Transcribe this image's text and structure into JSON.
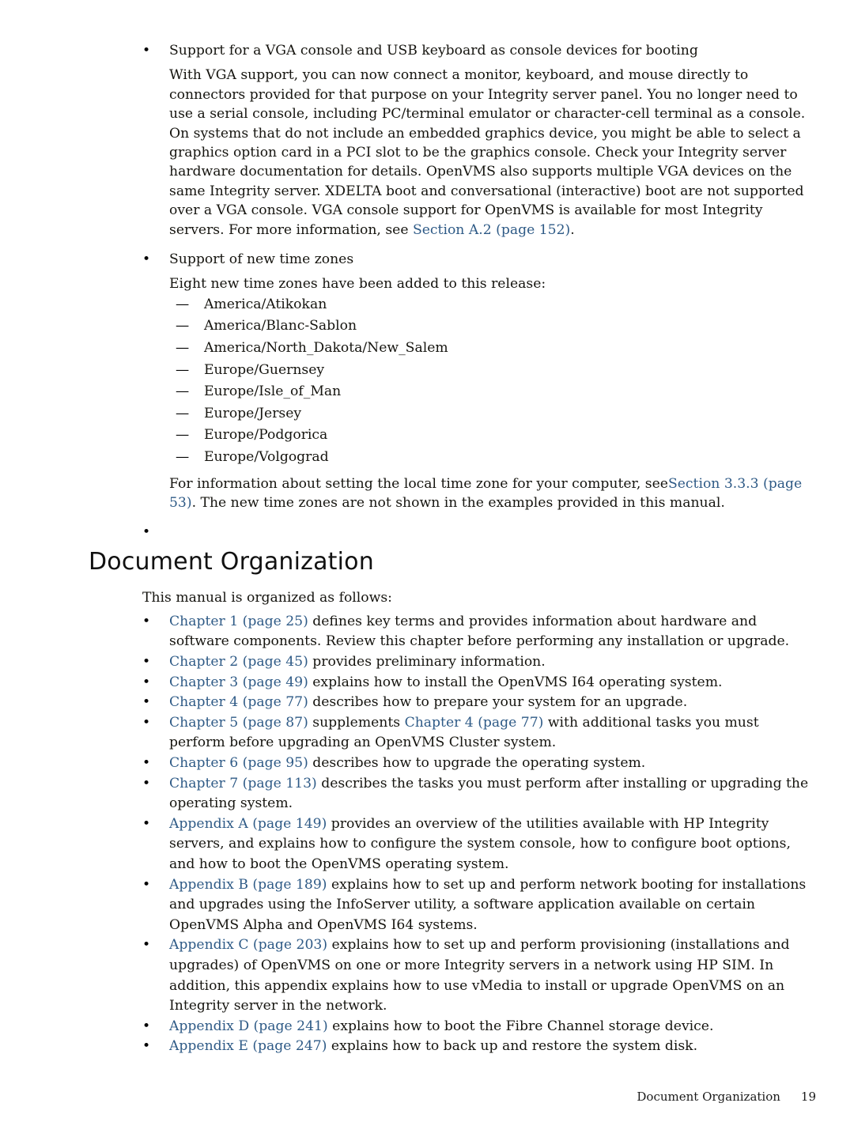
{
  "page": {
    "number": "19",
    "footer_title": "Document Organization"
  },
  "feature_list": {
    "vga": {
      "title": "Support for a VGA console and USB keyboard as console devices for booting",
      "body_before_link": "With VGA support, you can now connect a monitor, keyboard, and mouse directly to connectors provided for that purpose on your Integrity server panel. You no longer need to use a serial console, including PC/terminal emulator or character-cell terminal as a console. On systems that do not include an embedded graphics device, you might be able to select a graphics option card in a PCI slot to be the graphics console. Check your Integrity server hardware documentation for details. OpenVMS also supports multiple VGA devices on the same Integrity server. XDELTA boot and conversational (interactive) boot are not supported over a VGA console. VGA console support for OpenVMS is available for most Integrity servers. For more information, see ",
      "link": "Section A.2 (page 152)",
      "body_after_link": "."
    },
    "timezones": {
      "title": "Support of new time zones",
      "intro": "Eight new time zones have been added to this release:",
      "zones": [
        "America/Atikokan",
        "America/Blanc-Sablon",
        "America/North_Dakota/New_Salem",
        "Europe/Guernsey",
        "Europe/Isle_of_Man",
        "Europe/Jersey",
        "Europe/Podgorica",
        "Europe/Volgograd"
      ],
      "outro_before_link": "For information about setting the local time zone for your computer, see",
      "outro_link": "Section 3.3.3 (page 53)",
      "outro_after_link": ". The new time zones are not shown in the examples provided in this manual."
    },
    "empty_bullet": ""
  },
  "document_organization": {
    "heading": "Document Organization",
    "intro": "This manual is organized as follows:",
    "items": [
      {
        "link": "Chapter 1 (page 25)",
        "text": " defines key terms and provides information about hardware and software components. Review this chapter before performing any installation or upgrade."
      },
      {
        "link": "Chapter 2 (page 45)",
        "text": " provides preliminary information."
      },
      {
        "link": "Chapter 3 (page 49)",
        "text": " explains how to install the OpenVMS I64 operating system."
      },
      {
        "link": "Chapter 4 (page 77)",
        "text": " describes how to prepare your system for an upgrade."
      },
      {
        "link": "Chapter 5 (page 87)",
        "text": " supplements ",
        "link2": "Chapter 4 (page 77)",
        "text2": " with additional tasks you must perform before upgrading an OpenVMS Cluster system."
      },
      {
        "link": "Chapter 6 (page 95)",
        "text": " describes how to upgrade the operating system."
      },
      {
        "link": "Chapter 7 (page 113)",
        "text": " describes the tasks you must perform after installing or upgrading the operating system."
      },
      {
        "link": "Appendix A (page 149)",
        "text": " provides an overview of the utilities available with HP Integrity servers, and explains how to configure the system console, how to configure boot options, and how to boot the OpenVMS operating system."
      },
      {
        "link": "Appendix B (page 189)",
        "text": " explains how to set up and perform network booting for installations and upgrades using the InfoServer utility, a software application available on certain OpenVMS Alpha and OpenVMS I64 systems."
      },
      {
        "link": "Appendix C (page 203)",
        "text": " explains how to set up and perform provisioning (installations and upgrades) of OpenVMS on one or more Integrity servers in a network using HP SIM. In addition, this appendix explains how to use vMedia to install or upgrade OpenVMS on an Integrity server in the network."
      },
      {
        "link": "Appendix D (page 241)",
        "text": " explains how to boot the Fibre Channel storage device."
      },
      {
        "link": "Appendix E (page 247)",
        "text": " explains how to back up and restore the system disk."
      }
    ]
  },
  "colors": {
    "link": "#2e5a86",
    "body_text": "#15140f",
    "page_background": "#ffffff"
  }
}
